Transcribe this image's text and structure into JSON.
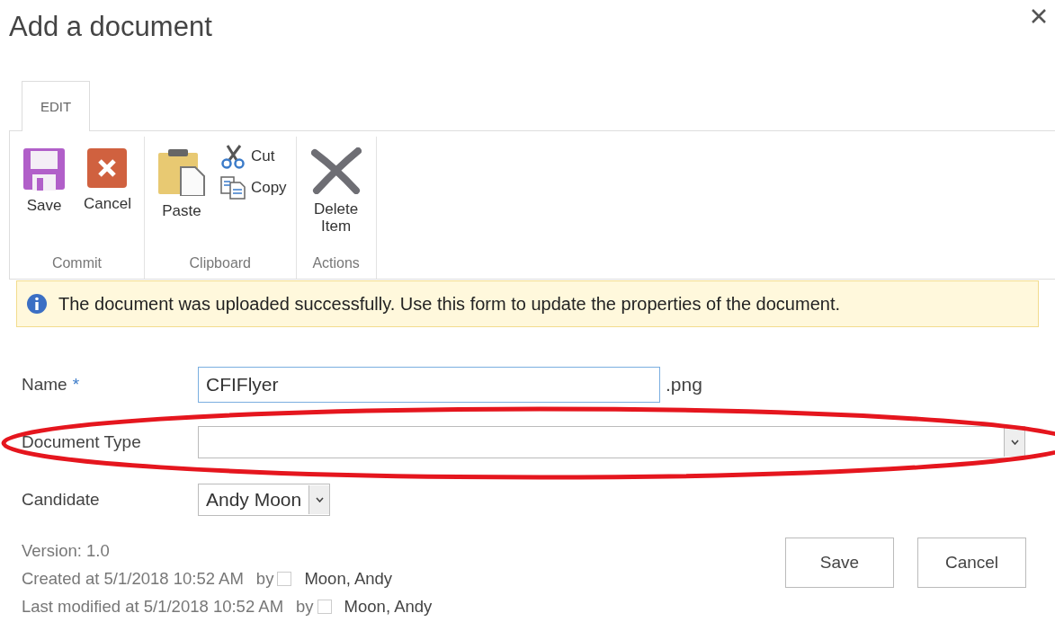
{
  "dialog": {
    "title": "Add a document"
  },
  "ribbon": {
    "tabs": [
      {
        "label": "EDIT",
        "selected": true
      }
    ],
    "groups": [
      {
        "label": "Commit",
        "commands": [
          {
            "label": "Save",
            "kind": "save"
          },
          {
            "label": "Cancel",
            "kind": "cancel"
          }
        ]
      },
      {
        "label": "Clipboard",
        "commands": [
          {
            "label": "Paste",
            "kind": "paste"
          },
          {
            "label": "Cut",
            "kind": "cut"
          },
          {
            "label": "Copy",
            "kind": "copy"
          }
        ]
      },
      {
        "label": "Actions",
        "commands": [
          {
            "label": "Delete Item",
            "kind": "delete"
          }
        ]
      }
    ]
  },
  "message": {
    "kind": "info",
    "text": "The document was uploaded successfully. Use this form to update the properties of the document."
  },
  "fields": [
    {
      "label": "Name",
      "required_mark": "*",
      "kind": "text",
      "value": "CFIFlyer",
      "suffix": ".png"
    },
    {
      "label": "Document Type",
      "kind": "select"
    },
    {
      "label": "Candidate",
      "kind": "select",
      "value": "Andy Moon"
    }
  ],
  "footer": {
    "version": "Version: 1.0",
    "entries": [
      {
        "text": "Created at 5/1/2018 10:52 AM",
        "by": "by",
        "user": "Moon, Andy"
      },
      {
        "text": "Last modified at 5/1/2018 10:52 AM",
        "by": "by",
        "user": "Moon, Andy"
      }
    ]
  },
  "buttons": [
    "Save",
    "Cancel"
  ]
}
